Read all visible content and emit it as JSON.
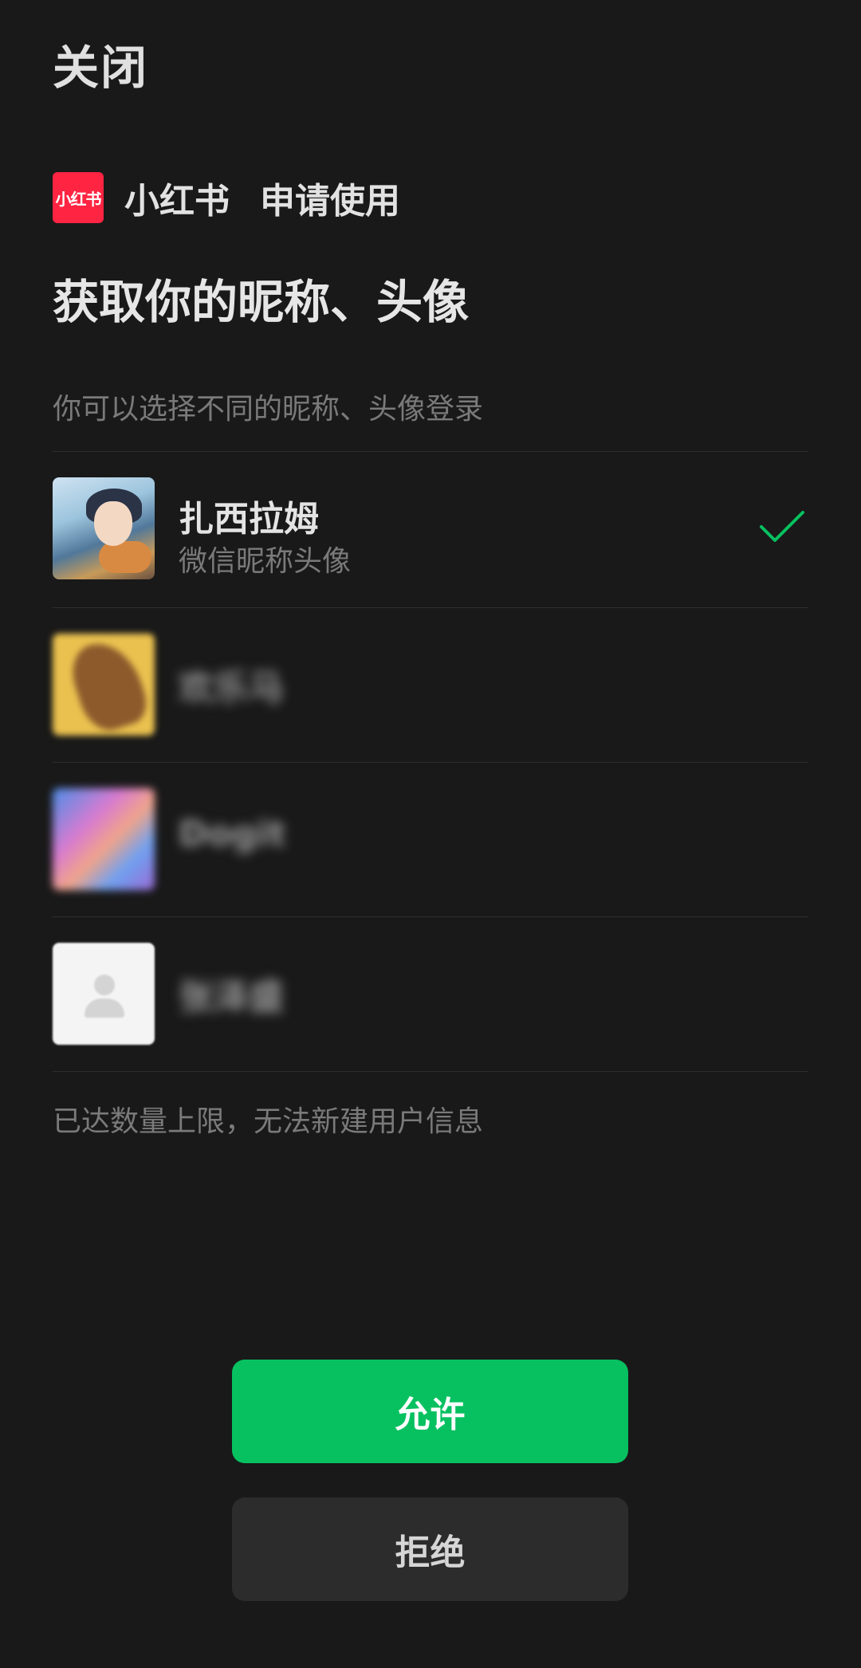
{
  "header": {
    "close_label": "关闭"
  },
  "app": {
    "logo_text": "小红书",
    "name": "小红书",
    "request_text": "申请使用"
  },
  "title": "获取你的昵称、头像",
  "subtitle": "你可以选择不同的昵称、头像登录",
  "accounts": [
    {
      "name": "扎西拉姆",
      "sub": "微信昵称头像",
      "selected": true
    },
    {
      "name": "欢乐马",
      "blurred": true
    },
    {
      "name": "Dogit",
      "blurred": true
    },
    {
      "name": "张泽盛",
      "blurred": true
    }
  ],
  "limit_note": "已达数量上限，无法新建用户信息",
  "buttons": {
    "allow": "允许",
    "deny": "拒绝"
  },
  "colors": {
    "background": "#191919",
    "accent": "#07c160",
    "logo_red": "#ff2442"
  }
}
